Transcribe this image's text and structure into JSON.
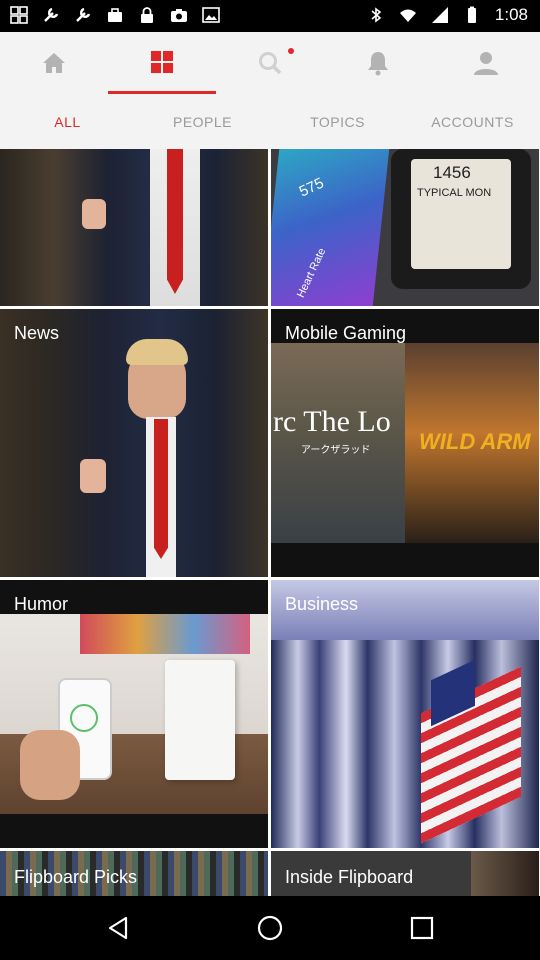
{
  "status_bar": {
    "time": "1:08"
  },
  "nav": {
    "items": [
      "home-icon",
      "grid-icon",
      "search-icon",
      "bell-icon",
      "profile-icon"
    ]
  },
  "tabs": [
    {
      "label": "ALL"
    },
    {
      "label": "PEOPLE"
    },
    {
      "label": "TOPICS"
    },
    {
      "label": "ACCOUNTS"
    }
  ],
  "tiles": [
    {
      "title": ""
    },
    {
      "title": ""
    },
    {
      "title": "News"
    },
    {
      "title": "Mobile Gaming"
    },
    {
      "title": "Humor"
    },
    {
      "title": "Business"
    },
    {
      "title": "Flipboard Picks"
    },
    {
      "title": "Inside Flipboard"
    }
  ],
  "images": {
    "watch_label": "TYPICAL MON",
    "watch_number": "1456",
    "watch_app_number": "575",
    "watch_app_label": "Heart Rate",
    "game_left_text": "rc The Lo",
    "game_left_sub": "アークザラッド",
    "game_right_text": "WILD ARM"
  },
  "colors": {
    "accent": "#e12828",
    "tab_inactive": "#9a9a9a",
    "nav_bg": "#f3f3f3"
  }
}
